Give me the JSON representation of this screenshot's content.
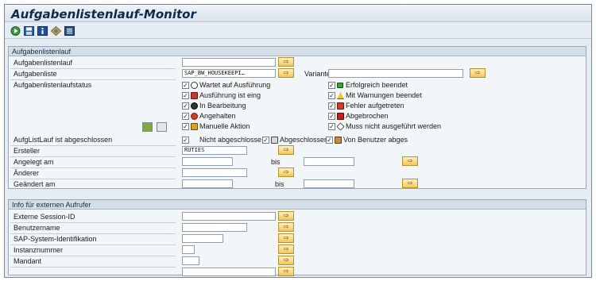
{
  "window": {
    "title": "Aufgabenlistenlauf-Monitor"
  },
  "toolbar": {
    "items": [
      "execute-icon",
      "save-variant-icon",
      "info-icon",
      "navigate-icon",
      "list-icon"
    ]
  },
  "section1": {
    "header": "Aufgabenlistenlauf",
    "labels": {
      "lauf": "Aufgabenlistenlauf",
      "liste": "Aufgabenliste",
      "status": "Aufgabenlistenlaufstatus",
      "abgeschlossen": "AufgListLauf ist abgeschlossen",
      "ersteller": "Ersteller",
      "angelegt": "Angelegt am",
      "aenderer": "Änderer",
      "geaendert": "Geändert am",
      "variante": "Variante",
      "bis1": "bis",
      "bis2": "bis"
    },
    "values": {
      "lauf": "",
      "liste": "SAP_BW_HOUSEKEEPI…",
      "variante": "",
      "ersteller": "RUTIES",
      "angelegt_von": "",
      "angelegt_bis": "",
      "aenderer": "",
      "geaendert_von": "",
      "geaendert_bis": ""
    },
    "status_left": [
      "Wartet auf Ausführung",
      "Ausführung ist eing",
      "In Bearbeitung",
      "Angehalten",
      "Manuelle Aktion"
    ],
    "status_right": [
      "Erfolgreich beendet",
      "Mit Warnungen beendet",
      "Fehler aufgetreten",
      "Abgebrochen",
      "Muss nicht ausgeführt werden"
    ],
    "abgeschlossen_options": [
      "Nicht abgeschlosse",
      "Abgeschlossen",
      "Von Benutzer abges"
    ],
    "checkbox_mark": "✓"
  },
  "section2": {
    "header": "Info für externen Aufrufer",
    "labels": {
      "session": "Externe Session-ID",
      "benutzer": "Benutzername",
      "system": "SAP-System-Identifikation",
      "instanz": "Instanznummer",
      "mandant": "Mandant"
    },
    "values": {
      "session": "",
      "benutzer": "",
      "system": "",
      "instanz": "",
      "mandant": "",
      "extra": ""
    }
  },
  "colors": {
    "accent": "#0d2a4a",
    "button": "#f2c75a",
    "panel": "#e6ecf3"
  }
}
